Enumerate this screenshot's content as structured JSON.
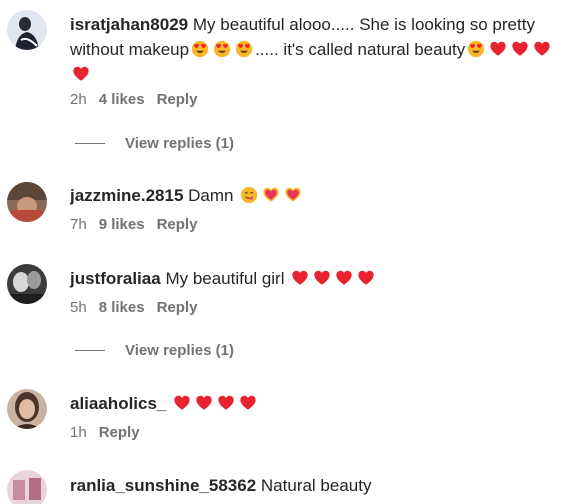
{
  "comments": [
    {
      "username": "isratjahan8029",
      "text_part1": "My beautiful alooo..... She is looking so pretty without makeup",
      "text_part2": "..... it's called natural beauty",
      "time": "2h",
      "likes": "4 likes",
      "reply": "Reply",
      "view_replies": "View replies (1)"
    },
    {
      "username": "jazzmine.2815",
      "text": "Damn",
      "time": "7h",
      "likes": "9 likes",
      "reply": "Reply"
    },
    {
      "username": "justforaliaa",
      "text": "My beautiful girl",
      "time": "5h",
      "likes": "8 likes",
      "reply": "Reply",
      "view_replies": "View replies (1)"
    },
    {
      "username": "aliaaholics_",
      "text": "",
      "time": "1h",
      "reply": "Reply"
    },
    {
      "username": "ranlia_sunshine_58362",
      "text": "Natural beauty"
    }
  ],
  "icons": {
    "heart_eyes": "heart-eyes-emoji",
    "red_heart": "red-heart-emoji",
    "yum_face": "yum-face-emoji",
    "heart_sparkle": "heart-with-ribbon-emoji"
  },
  "colors": {
    "text": "#262626",
    "secondary": "#737373",
    "heart_red": "#e8232f",
    "emoji_yellow": "#f7b728"
  }
}
